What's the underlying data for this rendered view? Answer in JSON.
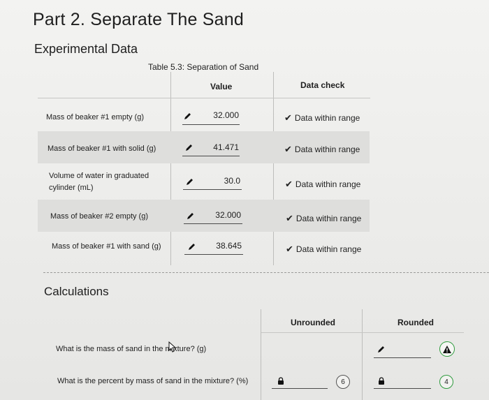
{
  "part_title": "Part 2. Separate The Sand",
  "section_experimental": "Experimental Data",
  "table": {
    "caption": "Table 5.3: Separation of Sand",
    "col_value": "Value",
    "col_check": "Data check",
    "rows": [
      {
        "label": "Mass of beaker #1 empty (g)",
        "value": "32.000",
        "check": "Data within range"
      },
      {
        "label": "Mass of beaker #1 with solid (g)",
        "value": "41.471",
        "check": "Data within range"
      },
      {
        "label": "Volume of water in graduated cylinder (mL)",
        "value": "30.0",
        "check": "Data within range"
      },
      {
        "label": "Mass of beaker #2 empty (g)",
        "value": "32.000",
        "check": "Data within range"
      },
      {
        "label": "Mass of beaker #1 with sand (g)",
        "value": "38.645",
        "check": "Data within range"
      }
    ]
  },
  "calculations": {
    "title": "Calculations",
    "col_unrounded": "Unrounded",
    "col_rounded": "Rounded",
    "questions": [
      {
        "label": "What is the mass of sand in the mixture? (g)",
        "rounded_badge": "!"
      },
      {
        "label": "What is the percent by mass of sand in the mixture? (%)",
        "unrounded_badge": "6",
        "rounded_badge": "4"
      }
    ]
  },
  "icons": {
    "edit": "pencil-icon",
    "check": "checkmark-icon",
    "lock": "lock-icon",
    "warning": "warning-icon",
    "cursor": "mouse-cursor-icon"
  },
  "colors": {
    "warning_ring": "#2f9b3e",
    "shade": "#dededc"
  }
}
